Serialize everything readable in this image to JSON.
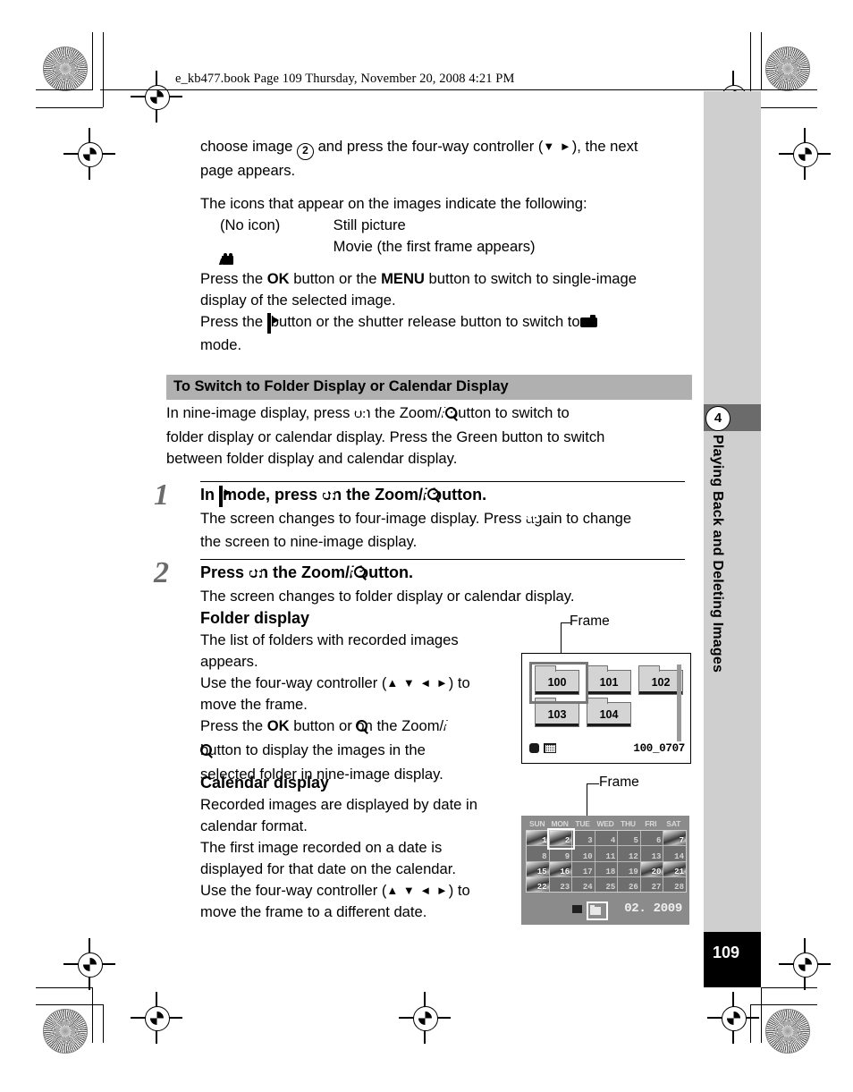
{
  "print_header": {
    "filename_line": "e_kb477.book  Page 109  Thursday, November 20, 2008  4:21 PM"
  },
  "intro": {
    "line1_pre": "choose image",
    "circled_number": "2",
    "line1_mid": "and press the four-way controller (",
    "line1_arrows": "▼ ►",
    "line1_post": "), the next",
    "line2": "page appears.",
    "icons_lead": "The icons that appear on the images indicate the following:",
    "legend": [
      {
        "icon": "(No icon)",
        "icon_kind": "text",
        "desc": "Still picture"
      },
      {
        "icon": "",
        "icon_kind": "movie-icon",
        "desc": "Movie (the first frame appears)"
      }
    ],
    "press_ok_1": "Press the",
    "ok_label": "OK",
    "press_ok_2": "button or the",
    "menu_label": "MENU",
    "press_ok_3": "button to switch to single-image",
    "press_ok_4": "display of the selected image.",
    "press_pb_1": "Press the",
    "press_pb_2": "button or the shutter release button to switch to",
    "press_pb_3": "mode."
  },
  "section": {
    "heading": "To Switch to Folder Display or Calendar Display",
    "para_1a": "In nine-image display, press",
    "para_1b": "on the Zoom/",
    "para_1c": "/",
    "para_1d": "button to switch to",
    "para_2": "folder display or calendar display. Press the Green button to switch",
    "para_3": "between folder display and calendar display."
  },
  "steps": [
    {
      "number": "1",
      "title_a": "In",
      "title_b": "mode, press",
      "title_c": "on the Zoom/",
      "title_d": "/",
      "title_e": "button.",
      "body_a": "The screen changes to four-image display. Press",
      "body_b": "again to change",
      "body_c": "the screen to nine-image display."
    },
    {
      "number": "2",
      "title_a": "Press",
      "title_b": "on the Zoom/",
      "title_c": "/",
      "title_d": "button.",
      "body_a": "The screen changes to folder display or calendar display."
    }
  ],
  "folder_display": {
    "heading": "Folder display",
    "line1": "The list of folders with recorded images",
    "line2": "appears.",
    "line3": "Use the four-way controller (",
    "line3_arrows": "▲ ▼ ◄ ►",
    "line3_end": ") to",
    "line4": "move the frame.",
    "line5a": "Press the",
    "line5_ok": "OK",
    "line5b": "button or",
    "line5c": "on the Zoom/",
    "line6a": "button to display the images in the",
    "line7": "selected folder in nine-image display.",
    "frame_label": "Frame",
    "screen": {
      "folders": [
        "100",
        "101",
        "102",
        "103",
        "104"
      ],
      "selected_folder": "100",
      "status_label": "100_0707"
    }
  },
  "calendar_display": {
    "heading": "Calendar display",
    "line1": "Recorded images are displayed by date in",
    "line2": "calendar format.",
    "line3": "The first image recorded on a date is",
    "line4": "displayed for that date on the calendar.",
    "line5": "Use the four-way controller (",
    "line5_arrows": "▲ ▼ ◄ ►",
    "line5_end": ") to",
    "line6": "move the frame to a different date.",
    "frame_label": "Frame",
    "screen": {
      "day_headers": [
        "SUN",
        "MON",
        "TUE",
        "WED",
        "THU",
        "FRI",
        "SAT"
      ],
      "days": [
        {
          "n": "1",
          "thumb": true
        },
        {
          "n": "2",
          "thumb": true,
          "selected": true
        },
        {
          "n": "3",
          "thumb": false
        },
        {
          "n": "4",
          "thumb": false
        },
        {
          "n": "5",
          "thumb": false
        },
        {
          "n": "6",
          "thumb": false
        },
        {
          "n": "7",
          "thumb": true
        },
        {
          "n": "8",
          "thumb": false
        },
        {
          "n": "9",
          "thumb": false
        },
        {
          "n": "10",
          "thumb": false
        },
        {
          "n": "11",
          "thumb": false
        },
        {
          "n": "12",
          "thumb": false
        },
        {
          "n": "13",
          "thumb": false
        },
        {
          "n": "14",
          "thumb": false
        },
        {
          "n": "15",
          "thumb": true
        },
        {
          "n": "16",
          "thumb": true
        },
        {
          "n": "17",
          "thumb": false
        },
        {
          "n": "18",
          "thumb": false
        },
        {
          "n": "19",
          "thumb": false
        },
        {
          "n": "20",
          "thumb": true
        },
        {
          "n": "21",
          "thumb": true
        },
        {
          "n": "22",
          "thumb": true
        },
        {
          "n": "23",
          "thumb": false
        },
        {
          "n": "24",
          "thumb": false
        },
        {
          "n": "25",
          "thumb": false
        },
        {
          "n": "26",
          "thumb": false
        },
        {
          "n": "27",
          "thumb": false
        },
        {
          "n": "28",
          "thumb": false
        }
      ],
      "status_label": "02. 2009"
    }
  },
  "chapter_tab": {
    "number": "4",
    "title": "Playing Back and Deleting Images"
  },
  "page_number": "109"
}
